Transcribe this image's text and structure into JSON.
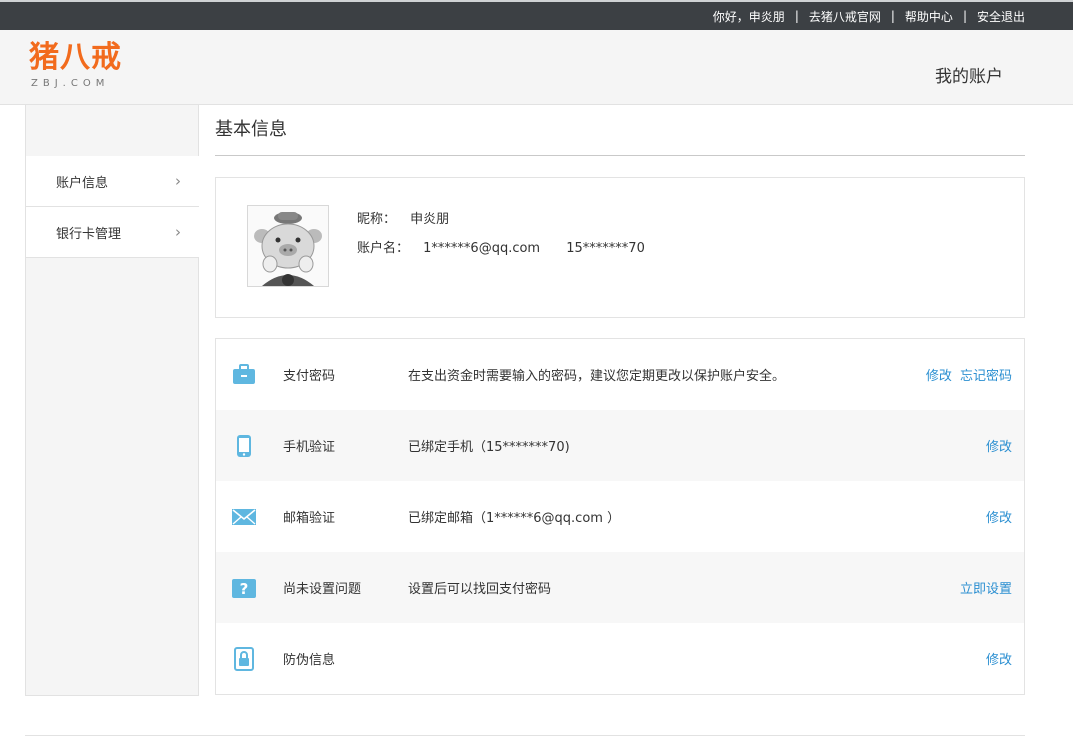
{
  "topbar": {
    "greeting": "你好，申炎朋",
    "links": [
      "去猪八戒官网",
      "帮助中心",
      "安全退出"
    ]
  },
  "header": {
    "logo_cn": "猪八戒",
    "logo_en": "ZBJ.COM",
    "title": "我的账户"
  },
  "sidebar": {
    "items": [
      {
        "label": "账户信息"
      },
      {
        "label": "银行卡管理"
      }
    ]
  },
  "main": {
    "section_title": "基本信息",
    "profile": {
      "nick_label": "昵称：",
      "nick_value": "申炎朋",
      "account_label": "账户名：",
      "account_email": "1******6@qq.com",
      "account_phone": "15*******70"
    },
    "security": [
      {
        "name": "支付密码",
        "desc": "在支出资金时需要输入的密码，建议您定期更改以保护账户安全。",
        "action": "修改",
        "action2": "忘记密码",
        "icon": "briefcase-icon"
      },
      {
        "name": "手机验证",
        "desc": "已绑定手机（15*******70)",
        "action": "修改",
        "icon": "mobile-icon"
      },
      {
        "name": "邮箱验证",
        "desc": "已绑定邮箱（1******6@qq.com ）",
        "action": "修改",
        "icon": "envelope-icon"
      },
      {
        "name": "尚未设置问题",
        "desc": "设置后可以找回支付密码",
        "action": "立即设置",
        "icon": "question-icon"
      },
      {
        "name": "防伪信息",
        "desc": "",
        "action": "修改",
        "icon": "lock-icon"
      }
    ]
  },
  "colors": {
    "topbar_bg": "#3c4044",
    "brand": "#f26b1d",
    "link": "#2b8fd1",
    "icon": "#5fb7e0"
  }
}
